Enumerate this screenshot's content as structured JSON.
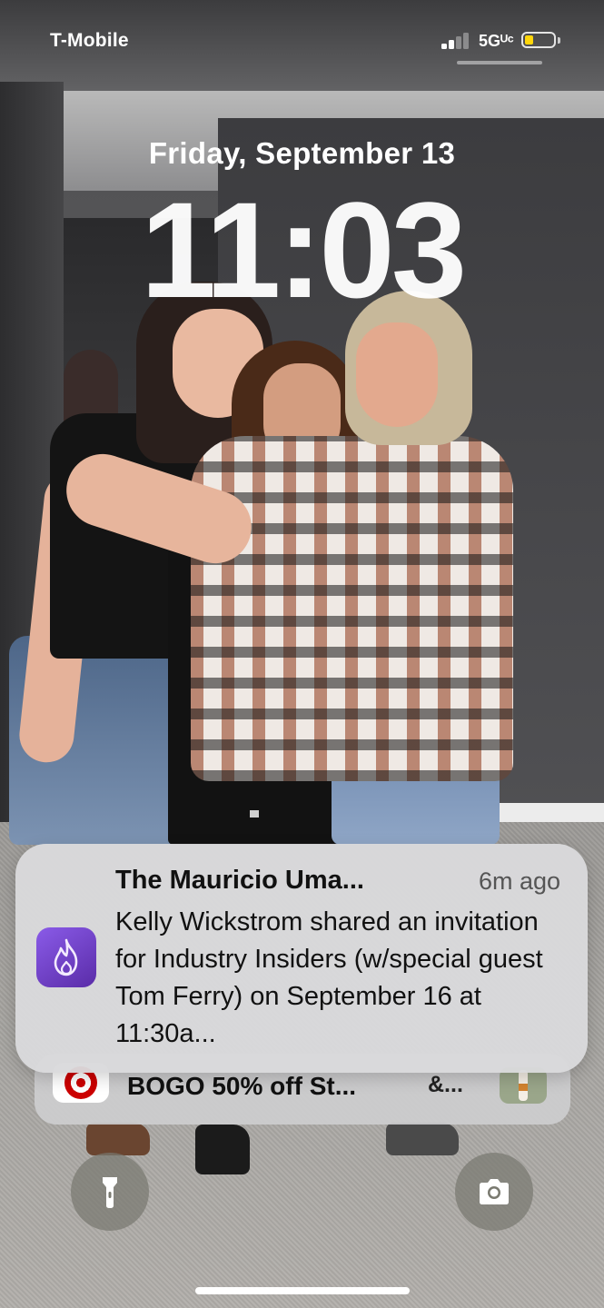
{
  "status_bar": {
    "carrier": "T-Mobile",
    "network": "5Gᵁᶜ",
    "signal_bars_active": 2,
    "signal_bars_total": 4,
    "battery_level": 0.3,
    "battery_color": "#ffd60a"
  },
  "lock_screen": {
    "date": "Friday, September 13",
    "time": "11:03"
  },
  "notification": {
    "app_icon": "flame-icon",
    "title": "The Mauricio Uma...",
    "timestamp": "6m ago",
    "body": "Kelly Wickstrom shared an invitation for Industry Insiders (w/special guest Tom Ferry) on September 16 at 11:30a..."
  },
  "stacked_notification": {
    "app_icon": "target-icon",
    "title": "BOGO 50% off St...",
    "more": "&..."
  },
  "quick_actions": {
    "left": "flashlight-icon",
    "right": "camera-icon"
  },
  "colors": {
    "notification_bg": "#dadadc",
    "app_icon_purple": "#7a45d6"
  }
}
